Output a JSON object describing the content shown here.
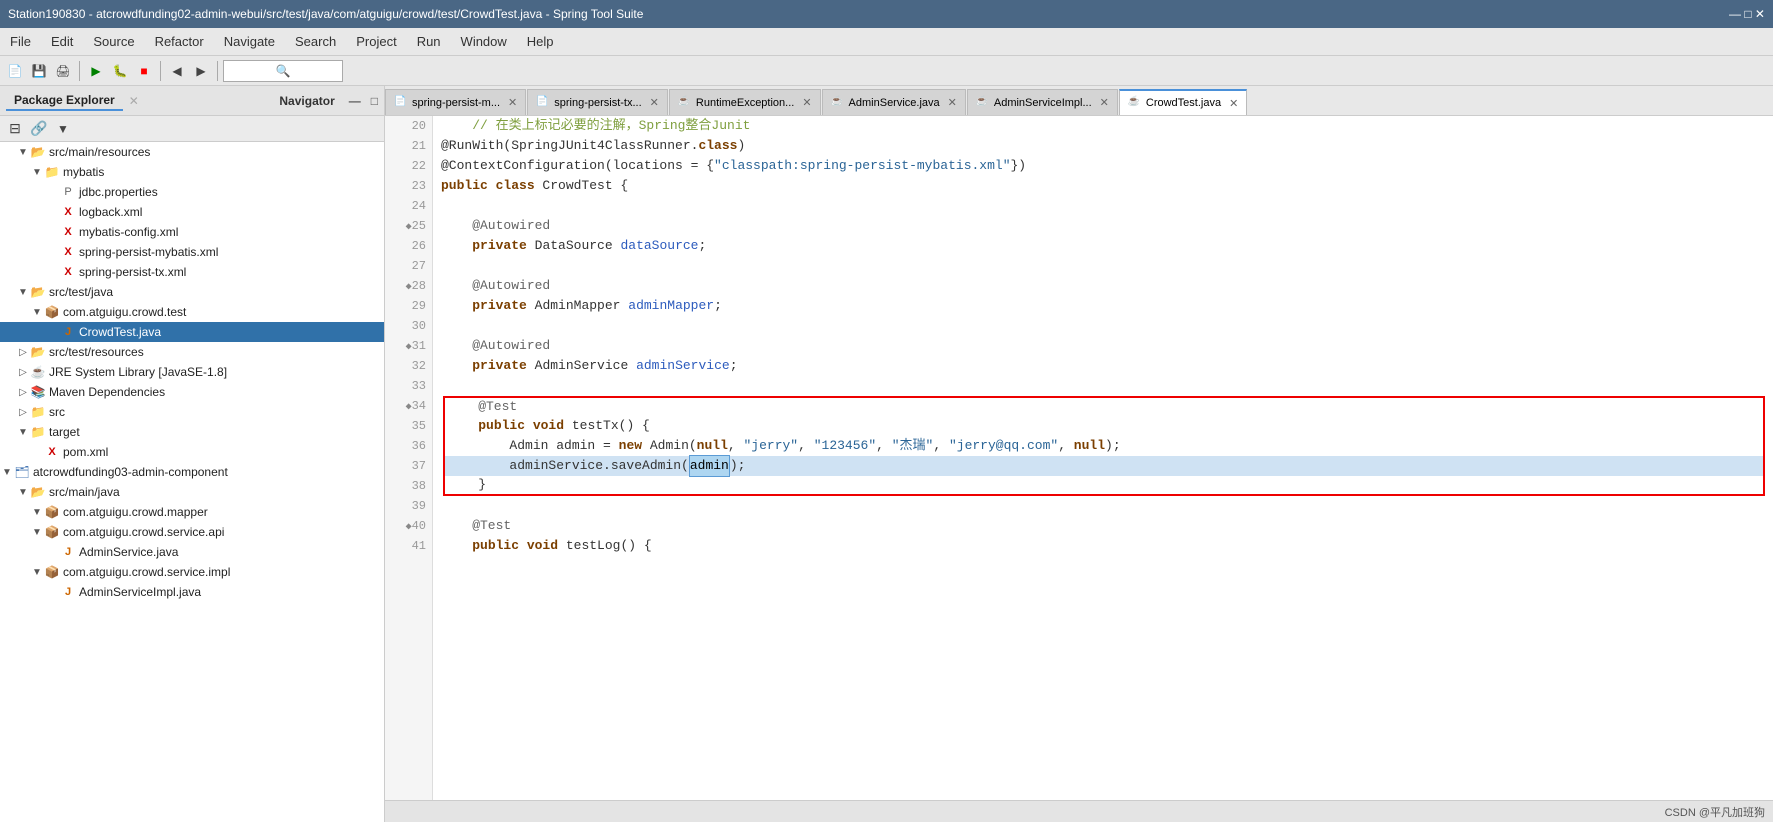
{
  "titleBar": {
    "text": "Station190830 - atcrowdfunding02-admin-webui/src/test/java/com/atguigu/crowd/test/CrowdTest.java - Spring Tool Suite"
  },
  "menuBar": {
    "items": [
      "File",
      "Edit",
      "Source",
      "Refactor",
      "Navigate",
      "Search",
      "Project",
      "Run",
      "Window",
      "Help"
    ]
  },
  "sidebar": {
    "title": "Package Explorer",
    "tabs": [
      "Package Explorer",
      "Navigator"
    ],
    "tree": [
      {
        "id": "src-main-resources",
        "label": "src/main/resources",
        "depth": 1,
        "type": "srcfolder",
        "expanded": true
      },
      {
        "id": "mybatis",
        "label": "mybatis",
        "depth": 2,
        "type": "folder",
        "expanded": true
      },
      {
        "id": "jdbc-properties",
        "label": "jdbc.properties",
        "depth": 3,
        "type": "properties"
      },
      {
        "id": "logback-xml",
        "label": "logback.xml",
        "depth": 3,
        "type": "xml"
      },
      {
        "id": "mybatis-config",
        "label": "mybatis-config.xml",
        "depth": 3,
        "type": "xml"
      },
      {
        "id": "spring-persist-mybatis",
        "label": "spring-persist-mybatis.xml",
        "depth": 3,
        "type": "xml"
      },
      {
        "id": "spring-persist-tx",
        "label": "spring-persist-tx.xml",
        "depth": 3,
        "type": "xml"
      },
      {
        "id": "src-test-java",
        "label": "src/test/java",
        "depth": 1,
        "type": "srcfolder",
        "expanded": true
      },
      {
        "id": "com-atguigu-crowd-test",
        "label": "com.atguigu.crowd.test",
        "depth": 2,
        "type": "package",
        "expanded": true
      },
      {
        "id": "CrowdTest-java",
        "label": "CrowdTest.java",
        "depth": 3,
        "type": "java",
        "selected": true
      },
      {
        "id": "src-test-resources",
        "label": "src/test/resources",
        "depth": 1,
        "type": "srcfolder"
      },
      {
        "id": "jre-system-library",
        "label": "JRE System Library [JavaSE-1.8]",
        "depth": 1,
        "type": "jre"
      },
      {
        "id": "maven-dependencies",
        "label": "Maven Dependencies",
        "depth": 1,
        "type": "maven"
      },
      {
        "id": "src",
        "label": "src",
        "depth": 1,
        "type": "folder"
      },
      {
        "id": "target",
        "label": "target",
        "depth": 1,
        "type": "folder",
        "expanded": true
      },
      {
        "id": "pom-xml",
        "label": "pom.xml",
        "depth": 2,
        "type": "xml"
      },
      {
        "id": "atcrowdfunding03",
        "label": "atcrowdfunding03-admin-component",
        "depth": 0,
        "type": "project",
        "expanded": true
      },
      {
        "id": "src-main-java",
        "label": "src/main/java",
        "depth": 1,
        "type": "srcfolder",
        "expanded": true
      },
      {
        "id": "com-atguigu-crowd-mapper",
        "label": "com.atguigu.crowd.mapper",
        "depth": 2,
        "type": "package",
        "expanded": true
      },
      {
        "id": "com-atguigu-crowd-service-api",
        "label": "com.atguigu.crowd.service.api",
        "depth": 2,
        "type": "package",
        "expanded": true
      },
      {
        "id": "AdminService-java",
        "label": "AdminService.java",
        "depth": 3,
        "type": "java"
      },
      {
        "id": "com-atguigu-crowd-service-impl",
        "label": "com.atguigu.crowd.service.impl",
        "depth": 2,
        "type": "package",
        "expanded": true
      },
      {
        "id": "AdminServiceImpl-java",
        "label": "AdminServiceImpl.java",
        "depth": 3,
        "type": "java"
      }
    ]
  },
  "tabs": [
    {
      "label": "spring-persist-m...",
      "type": "xml",
      "active": false
    },
    {
      "label": "spring-persist-tx...",
      "type": "xml",
      "active": false
    },
    {
      "label": "RuntimeException...",
      "type": "java",
      "active": false
    },
    {
      "label": "AdminService.java",
      "type": "java",
      "active": false
    },
    {
      "label": "AdminServiceImpl...",
      "type": "java",
      "active": false
    },
    {
      "label": "CrowdTest.java",
      "type": "java",
      "active": true
    }
  ],
  "codeLines": [
    {
      "num": 20,
      "marker": "",
      "content_parts": [
        {
          "text": "    // 在类上标记必要的注解，Spring整合Junit",
          "class": "comment"
        }
      ]
    },
    {
      "num": 21,
      "marker": "",
      "content_parts": [
        {
          "text": "@RunWith(SpringJUnit4ClassRunner.",
          "class": "plain"
        },
        {
          "text": "class",
          "class": "kw"
        },
        {
          "text": ")",
          "class": "plain"
        }
      ]
    },
    {
      "num": 22,
      "marker": "",
      "content_parts": [
        {
          "text": "@ContextConfiguration(locations = {",
          "class": "plain"
        },
        {
          "text": "\"classpath:spring-persist-mybatis.xml\"",
          "class": "str"
        },
        {
          "text": "})",
          "class": "plain"
        }
      ]
    },
    {
      "num": 23,
      "marker": "",
      "content_parts": [
        {
          "text": "public ",
          "class": "kw"
        },
        {
          "text": "class ",
          "class": "kw"
        },
        {
          "text": "CrowdTest {",
          "class": "plain"
        }
      ]
    },
    {
      "num": 24,
      "marker": "",
      "content_parts": [
        {
          "text": "",
          "class": "plain"
        }
      ]
    },
    {
      "num": 25,
      "marker": "◆",
      "content_parts": [
        {
          "text": "    @Autowired",
          "class": "ann"
        }
      ]
    },
    {
      "num": 26,
      "marker": "",
      "content_parts": [
        {
          "text": "    ",
          "class": "plain"
        },
        {
          "text": "private ",
          "class": "kw"
        },
        {
          "text": "DataSource ",
          "class": "plain"
        },
        {
          "text": "dataSource",
          "class": "type"
        },
        {
          "text": ";",
          "class": "plain"
        }
      ]
    },
    {
      "num": 27,
      "marker": "",
      "content_parts": [
        {
          "text": "",
          "class": "plain"
        }
      ]
    },
    {
      "num": 28,
      "marker": "◆",
      "content_parts": [
        {
          "text": "    @Autowired",
          "class": "ann"
        }
      ]
    },
    {
      "num": 29,
      "marker": "",
      "content_parts": [
        {
          "text": "    ",
          "class": "plain"
        },
        {
          "text": "private ",
          "class": "kw"
        },
        {
          "text": "AdminMapper ",
          "class": "plain"
        },
        {
          "text": "adminMapper",
          "class": "type"
        },
        {
          "text": ";",
          "class": "plain"
        }
      ]
    },
    {
      "num": 30,
      "marker": "",
      "content_parts": [
        {
          "text": "",
          "class": "plain"
        }
      ]
    },
    {
      "num": 31,
      "marker": "◆",
      "content_parts": [
        {
          "text": "    @Autowired",
          "class": "ann"
        }
      ]
    },
    {
      "num": 32,
      "marker": "",
      "content_parts": [
        {
          "text": "    ",
          "class": "plain"
        },
        {
          "text": "private ",
          "class": "kw"
        },
        {
          "text": "AdminService ",
          "class": "plain"
        },
        {
          "text": "adminService",
          "class": "type"
        },
        {
          "text": ";",
          "class": "plain"
        }
      ]
    },
    {
      "num": 33,
      "marker": "",
      "content_parts": [
        {
          "text": "",
          "class": "plain"
        }
      ]
    },
    {
      "num": 34,
      "marker": "◆",
      "content_parts": [
        {
          "text": "    @Test",
          "class": "ann"
        }
      ],
      "boxStart": true
    },
    {
      "num": 35,
      "marker": "",
      "content_parts": [
        {
          "text": "    ",
          "class": "plain"
        },
        {
          "text": "public ",
          "class": "kw"
        },
        {
          "text": "void ",
          "class": "kw"
        },
        {
          "text": "testTx() {",
          "class": "plain"
        }
      ]
    },
    {
      "num": 36,
      "marker": "",
      "content_parts": [
        {
          "text": "        Admin admin = ",
          "class": "plain"
        },
        {
          "text": "new ",
          "class": "kw"
        },
        {
          "text": "Admin(",
          "class": "plain"
        },
        {
          "text": "null",
          "class": "kw"
        },
        {
          "text": ", ",
          "class": "plain"
        },
        {
          "text": "\"jerry\"",
          "class": "str"
        },
        {
          "text": ", ",
          "class": "plain"
        },
        {
          "text": "\"123456\"",
          "class": "str"
        },
        {
          "text": ", ",
          "class": "plain"
        },
        {
          "text": "\"杰瑞\"",
          "class": "str"
        },
        {
          "text": ", ",
          "class": "plain"
        },
        {
          "text": "\"jerry@qq.com\"",
          "class": "str"
        },
        {
          "text": ", ",
          "class": "plain"
        },
        {
          "text": "null",
          "class": "kw"
        },
        {
          "text": ");",
          "class": "plain"
        }
      ]
    },
    {
      "num": 37,
      "marker": "",
      "content_parts": [
        {
          "text": "        adminService.saveAdmin(",
          "class": "plain"
        },
        {
          "text": "admin",
          "class": "highlighted-word"
        },
        {
          "text": ");",
          "class": "plain"
        }
      ],
      "highlighted": true
    },
    {
      "num": 38,
      "marker": "",
      "content_parts": [
        {
          "text": "    }",
          "class": "plain"
        }
      ],
      "boxEnd": true
    },
    {
      "num": 39,
      "marker": "",
      "content_parts": [
        {
          "text": "",
          "class": "plain"
        }
      ]
    },
    {
      "num": 40,
      "marker": "◆",
      "content_parts": [
        {
          "text": "    @Test",
          "class": "ann"
        }
      ]
    },
    {
      "num": 41,
      "marker": "",
      "content_parts": [
        {
          "text": "    ",
          "class": "plain"
        },
        {
          "text": "public ",
          "class": "kw"
        },
        {
          "text": "void ",
          "class": "kw"
        },
        {
          "text": "testLog() {",
          "class": "plain"
        }
      ]
    }
  ],
  "statusBar": {
    "text": "CSDN @平凡加班狗"
  }
}
